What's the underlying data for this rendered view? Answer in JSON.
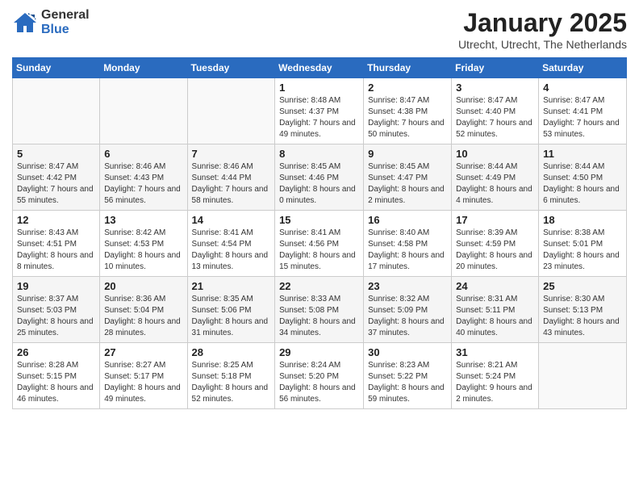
{
  "header": {
    "logo_general": "General",
    "logo_blue": "Blue",
    "month": "January 2025",
    "location": "Utrecht, Utrecht, The Netherlands"
  },
  "weekdays": [
    "Sunday",
    "Monday",
    "Tuesday",
    "Wednesday",
    "Thursday",
    "Friday",
    "Saturday"
  ],
  "weeks": [
    [
      {
        "day": "",
        "info": ""
      },
      {
        "day": "",
        "info": ""
      },
      {
        "day": "",
        "info": ""
      },
      {
        "day": "1",
        "info": "Sunrise: 8:48 AM\nSunset: 4:37 PM\nDaylight: 7 hours and 49 minutes."
      },
      {
        "day": "2",
        "info": "Sunrise: 8:47 AM\nSunset: 4:38 PM\nDaylight: 7 hours and 50 minutes."
      },
      {
        "day": "3",
        "info": "Sunrise: 8:47 AM\nSunset: 4:40 PM\nDaylight: 7 hours and 52 minutes."
      },
      {
        "day": "4",
        "info": "Sunrise: 8:47 AM\nSunset: 4:41 PM\nDaylight: 7 hours and 53 minutes."
      }
    ],
    [
      {
        "day": "5",
        "info": "Sunrise: 8:47 AM\nSunset: 4:42 PM\nDaylight: 7 hours and 55 minutes."
      },
      {
        "day": "6",
        "info": "Sunrise: 8:46 AM\nSunset: 4:43 PM\nDaylight: 7 hours and 56 minutes."
      },
      {
        "day": "7",
        "info": "Sunrise: 8:46 AM\nSunset: 4:44 PM\nDaylight: 7 hours and 58 minutes."
      },
      {
        "day": "8",
        "info": "Sunrise: 8:45 AM\nSunset: 4:46 PM\nDaylight: 8 hours and 0 minutes."
      },
      {
        "day": "9",
        "info": "Sunrise: 8:45 AM\nSunset: 4:47 PM\nDaylight: 8 hours and 2 minutes."
      },
      {
        "day": "10",
        "info": "Sunrise: 8:44 AM\nSunset: 4:49 PM\nDaylight: 8 hours and 4 minutes."
      },
      {
        "day": "11",
        "info": "Sunrise: 8:44 AM\nSunset: 4:50 PM\nDaylight: 8 hours and 6 minutes."
      }
    ],
    [
      {
        "day": "12",
        "info": "Sunrise: 8:43 AM\nSunset: 4:51 PM\nDaylight: 8 hours and 8 minutes."
      },
      {
        "day": "13",
        "info": "Sunrise: 8:42 AM\nSunset: 4:53 PM\nDaylight: 8 hours and 10 minutes."
      },
      {
        "day": "14",
        "info": "Sunrise: 8:41 AM\nSunset: 4:54 PM\nDaylight: 8 hours and 13 minutes."
      },
      {
        "day": "15",
        "info": "Sunrise: 8:41 AM\nSunset: 4:56 PM\nDaylight: 8 hours and 15 minutes."
      },
      {
        "day": "16",
        "info": "Sunrise: 8:40 AM\nSunset: 4:58 PM\nDaylight: 8 hours and 17 minutes."
      },
      {
        "day": "17",
        "info": "Sunrise: 8:39 AM\nSunset: 4:59 PM\nDaylight: 8 hours and 20 minutes."
      },
      {
        "day": "18",
        "info": "Sunrise: 8:38 AM\nSunset: 5:01 PM\nDaylight: 8 hours and 23 minutes."
      }
    ],
    [
      {
        "day": "19",
        "info": "Sunrise: 8:37 AM\nSunset: 5:03 PM\nDaylight: 8 hours and 25 minutes."
      },
      {
        "day": "20",
        "info": "Sunrise: 8:36 AM\nSunset: 5:04 PM\nDaylight: 8 hours and 28 minutes."
      },
      {
        "day": "21",
        "info": "Sunrise: 8:35 AM\nSunset: 5:06 PM\nDaylight: 8 hours and 31 minutes."
      },
      {
        "day": "22",
        "info": "Sunrise: 8:33 AM\nSunset: 5:08 PM\nDaylight: 8 hours and 34 minutes."
      },
      {
        "day": "23",
        "info": "Sunrise: 8:32 AM\nSunset: 5:09 PM\nDaylight: 8 hours and 37 minutes."
      },
      {
        "day": "24",
        "info": "Sunrise: 8:31 AM\nSunset: 5:11 PM\nDaylight: 8 hours and 40 minutes."
      },
      {
        "day": "25",
        "info": "Sunrise: 8:30 AM\nSunset: 5:13 PM\nDaylight: 8 hours and 43 minutes."
      }
    ],
    [
      {
        "day": "26",
        "info": "Sunrise: 8:28 AM\nSunset: 5:15 PM\nDaylight: 8 hours and 46 minutes."
      },
      {
        "day": "27",
        "info": "Sunrise: 8:27 AM\nSunset: 5:17 PM\nDaylight: 8 hours and 49 minutes."
      },
      {
        "day": "28",
        "info": "Sunrise: 8:25 AM\nSunset: 5:18 PM\nDaylight: 8 hours and 52 minutes."
      },
      {
        "day": "29",
        "info": "Sunrise: 8:24 AM\nSunset: 5:20 PM\nDaylight: 8 hours and 56 minutes."
      },
      {
        "day": "30",
        "info": "Sunrise: 8:23 AM\nSunset: 5:22 PM\nDaylight: 8 hours and 59 minutes."
      },
      {
        "day": "31",
        "info": "Sunrise: 8:21 AM\nSunset: 5:24 PM\nDaylight: 9 hours and 2 minutes."
      },
      {
        "day": "",
        "info": ""
      }
    ]
  ]
}
